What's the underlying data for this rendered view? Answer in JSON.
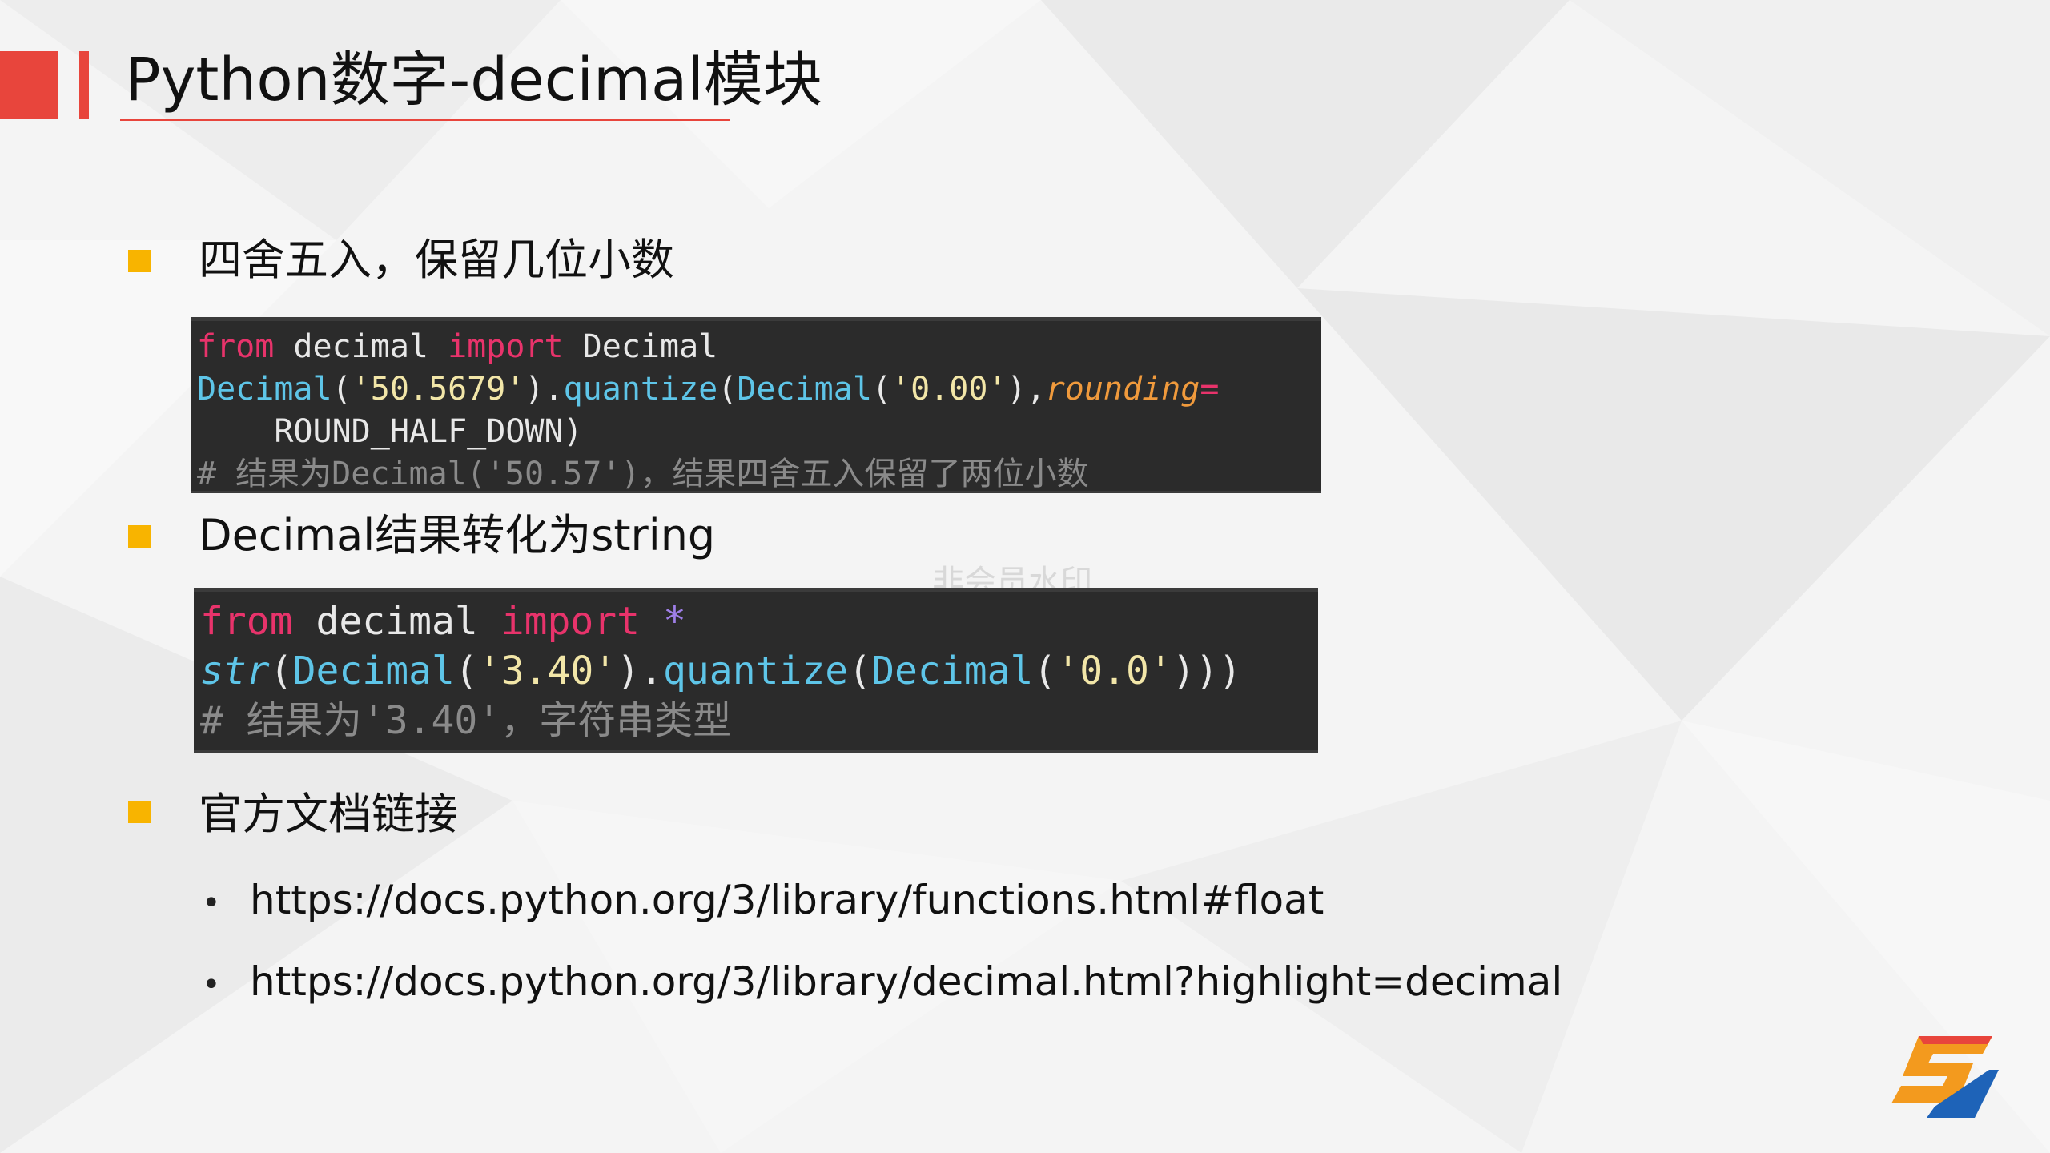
{
  "title": "Python数字-decimal模块",
  "sections": [
    {
      "label": "四舍五入，保留几位小数"
    },
    {
      "label": "Decimal结果转化为string"
    },
    {
      "label": "官方文档链接"
    }
  ],
  "code1": {
    "line1": {
      "k1": "from",
      "n1": " decimal ",
      "k2": "import",
      "n2": " Decimal"
    },
    "line2": {
      "c1": "Decimal",
      "p1": "(",
      "s1": "'50.5679'",
      "p2": ").",
      "c2": "quantize",
      "p3": "(",
      "c3": "Decimal",
      "p4": "(",
      "s2": "'0.00'",
      "p5": "),",
      "i1": "rounding",
      "op": "="
    },
    "line3": {
      "n": "    ROUND_HALF_DOWN)"
    },
    "line4": {
      "comment": "# 结果为Decimal('50.57')，结果四舍五入保留了两位小数"
    }
  },
  "code2": {
    "line1": {
      "k1": "from",
      "n1": " decimal ",
      "k2": "import",
      "star": " *"
    },
    "line2": {
      "c1": "str",
      "p1": "(",
      "c2": "Decimal",
      "p2": "(",
      "s1": "'3.40'",
      "p3": ").",
      "c3": "quantize",
      "p4": "(",
      "c4": "Decimal",
      "p5": "(",
      "s2": "'0.0'",
      "p6": ")))"
    },
    "line3": {
      "comment": "# 结果为'3.40'，字符串类型"
    }
  },
  "watermark": "非会员水印",
  "links": [
    {
      "bullet": "•",
      "url": "https://docs.python.org/3/library/functions.html#float"
    },
    {
      "bullet": "•",
      "url": "https://docs.python.org/3/library/decimal.html?highlight=decimal"
    }
  ],
  "colors": {
    "accent_red": "#e8453c",
    "bullet_yellow": "#f8b400",
    "code_bg": "#2b2b2b"
  },
  "logo": {
    "icon": "s-logo-icon"
  }
}
